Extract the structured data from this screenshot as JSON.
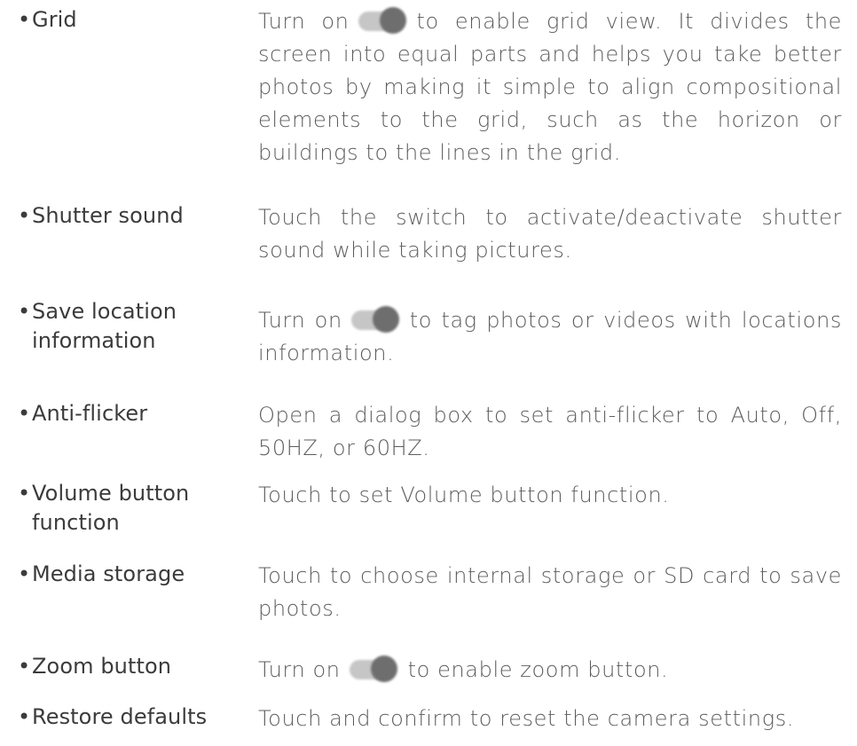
{
  "items": [
    {
      "term_lines": [
        "Grid"
      ],
      "segments": [
        "Turn on",
        "to enable grid view. It divides the screen into equal parts and helps you take better photos by making it simple to align compositional elements to the grid, such as the horizon or buildings to the lines in the grid."
      ],
      "has_toggle": true
    },
    {
      "term_lines": [
        "Shutter sound"
      ],
      "segments": [
        "Touch the switch to activate/deactivate shutter sound while taking pictures."
      ],
      "has_toggle": false
    },
    {
      "term_lines": [
        "Save location",
        "information"
      ],
      "segments": [
        "Turn on",
        "to tag photos or videos with locations information."
      ],
      "has_toggle": true
    },
    {
      "term_lines": [
        "Anti-flicker"
      ],
      "segments": [
        "Open a dialog box to set anti-flicker to Auto, Off, 50HZ, or 60HZ."
      ],
      "has_toggle": false
    },
    {
      "term_lines": [
        "Volume button",
        "function"
      ],
      "segments": [
        "Touch to set Volume button function."
      ],
      "has_toggle": false
    },
    {
      "term_lines": [
        "Media storage"
      ],
      "segments": [
        "Touch to choose internal storage or SD card to save photos."
      ],
      "has_toggle": false
    },
    {
      "term_lines": [
        "Zoom button"
      ],
      "segments": [
        "Turn on",
        "to enable zoom button."
      ],
      "has_toggle": true
    },
    {
      "term_lines": [
        "Restore defaults"
      ],
      "segments": [
        "Touch and confirm to reset the camera settings."
      ],
      "has_toggle": false
    }
  ],
  "icons": {
    "toggle": "toggle-switch-on-icon",
    "bullet": "bullet-icon"
  },
  "colors": {
    "term_text": "#3b3b3b",
    "desc_text": "#5c5c5c",
    "toggle_track": "#c6c6c6",
    "toggle_knob": "#6e6e6e"
  }
}
